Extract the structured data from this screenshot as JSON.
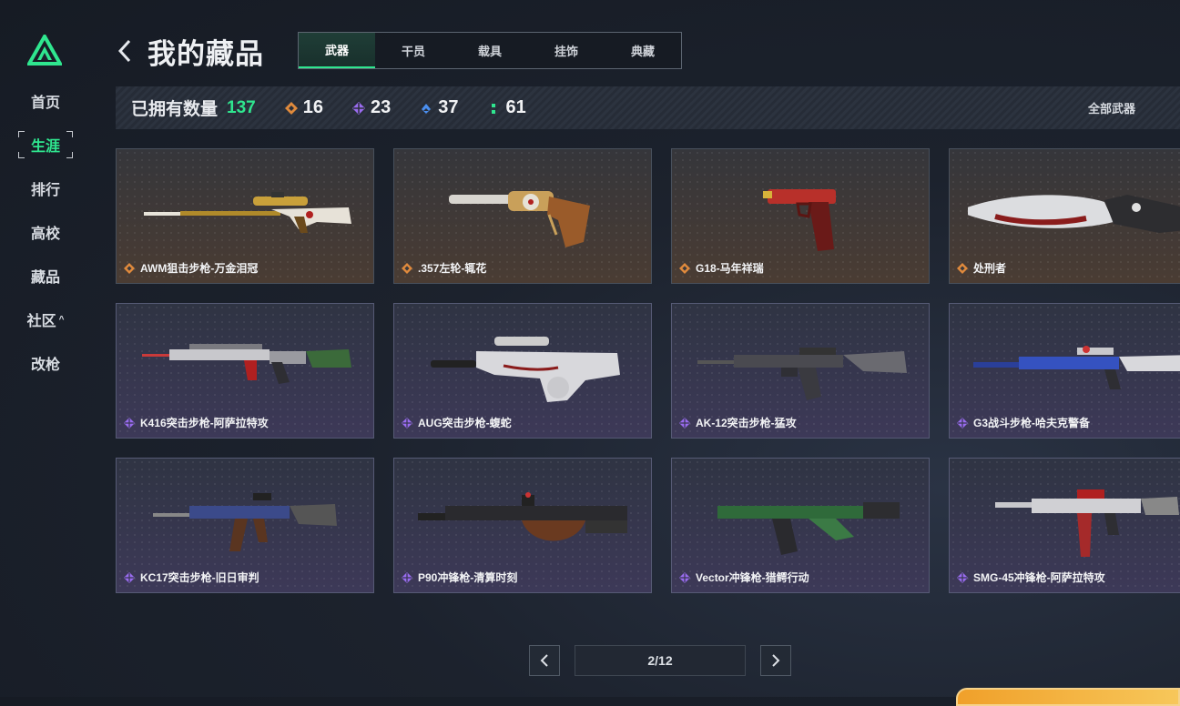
{
  "colors": {
    "accent": "#2fe68f",
    "legendary": "#e08a3c",
    "epic": "#9a6cf0",
    "rare": "#4a8ff0",
    "common": "#2fe68f"
  },
  "sidebar": {
    "logo_icon": "triangle-logo-icon",
    "items": [
      {
        "label": "首页"
      },
      {
        "label": "生涯",
        "active": true
      },
      {
        "label": "排行"
      },
      {
        "label": "高校"
      },
      {
        "label": "藏品"
      },
      {
        "label": "社区",
        "chevron": "^"
      },
      {
        "label": "改枪"
      }
    ]
  },
  "header": {
    "title": "我的藏品",
    "tabs": [
      {
        "label": "武器",
        "active": true
      },
      {
        "label": "干员"
      },
      {
        "label": "载具"
      },
      {
        "label": "挂饰"
      },
      {
        "label": "典藏"
      }
    ]
  },
  "stats": {
    "owned_label": "已拥有数量",
    "owned_count": "137",
    "rarities": [
      {
        "icon": "legendary-diamond-icon",
        "count": "16"
      },
      {
        "icon": "epic-diamond-icon",
        "count": "23"
      },
      {
        "icon": "rare-diamond-icon",
        "count": "37"
      },
      {
        "icon": "common-dots-icon",
        "count": "61"
      }
    ],
    "filter_label": "全部武器"
  },
  "items": [
    {
      "name": "AWM狙击步枪-万金泪冠",
      "rarity": "legendary"
    },
    {
      "name": ".357左轮-辄花",
      "rarity": "legendary"
    },
    {
      "name": "G18-马年祥瑞",
      "rarity": "legendary"
    },
    {
      "name": "处刑者",
      "rarity": "legendary"
    },
    {
      "name": "K416突击步枪-阿萨拉特攻",
      "rarity": "epic"
    },
    {
      "name": "AUG突击步枪-蝮蛇",
      "rarity": "epic"
    },
    {
      "name": "AK-12突击步枪-猛攻",
      "rarity": "epic"
    },
    {
      "name": "G3战斗步枪-哈夫克警备",
      "rarity": "epic"
    },
    {
      "name": "KC17突击步枪-旧日审判",
      "rarity": "epic"
    },
    {
      "name": "P90冲锋枪-清算时刻",
      "rarity": "epic"
    },
    {
      "name": "Vector冲锋枪-猎鳄行动",
      "rarity": "epic"
    },
    {
      "name": "SMG-45冲锋枪-阿萨拉特攻",
      "rarity": "epic"
    }
  ],
  "pagination": {
    "page": "2/12",
    "prev_icon": "chevron-left-icon",
    "next_icon": "chevron-right-icon"
  }
}
